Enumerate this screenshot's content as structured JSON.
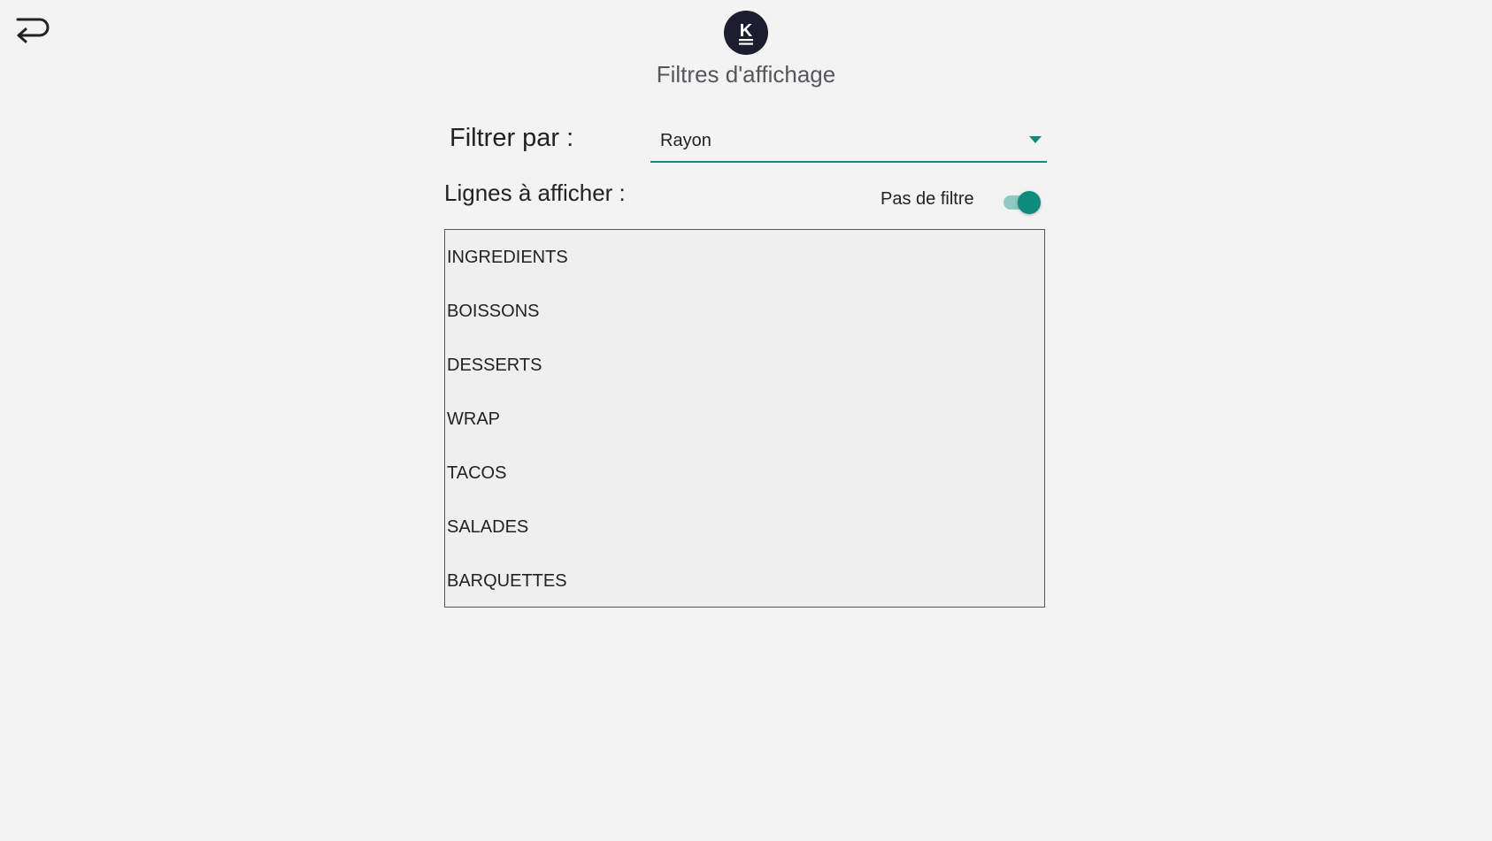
{
  "header": {
    "title": "Filtres d'affichage",
    "back_icon": "return-arrow-icon",
    "logo_letter": "K"
  },
  "filter": {
    "label": "Filtrer par :",
    "selected": "Rayon",
    "accent_color": "#0d8b7e"
  },
  "lines": {
    "label": "Lignes à afficher :",
    "no_filter_label": "Pas de filtre",
    "no_filter_enabled": true,
    "items": [
      "INGREDIENTS",
      "BOISSONS",
      "DESSERTS",
      "WRAP",
      "TACOS",
      "SALADES",
      "BARQUETTES"
    ]
  }
}
